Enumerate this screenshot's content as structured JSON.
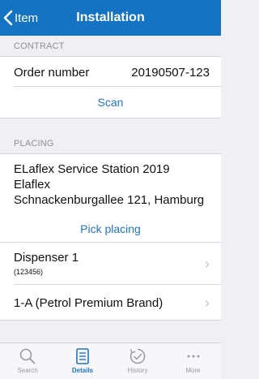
{
  "nav": {
    "back_label": "Item",
    "title": "Installation"
  },
  "contract": {
    "header": "CONTRACT",
    "order_label": "Order number",
    "order_value": "20190507-123",
    "scan_label": "Scan"
  },
  "placing": {
    "header": "PLACING",
    "station_name": "ELaflex Service Station 2019",
    "company": "Elaflex",
    "address": "Schnackenburgallee 121, Hamburg",
    "pick_label": "Pick placing",
    "dispenser_title": "Dispenser 1",
    "dispenser_code": "(123456)",
    "nozzle_label": "1-A (Petrol Premium Brand)"
  },
  "tabs": [
    {
      "label": "Search",
      "icon": "search-icon"
    },
    {
      "label": "Details",
      "icon": "details-icon"
    },
    {
      "label": "History",
      "icon": "history-icon"
    },
    {
      "label": "More",
      "icon": "more-icon"
    }
  ],
  "colors": {
    "accent": "#1573c4",
    "link": "#1f74c9",
    "background": "#efeff4"
  }
}
